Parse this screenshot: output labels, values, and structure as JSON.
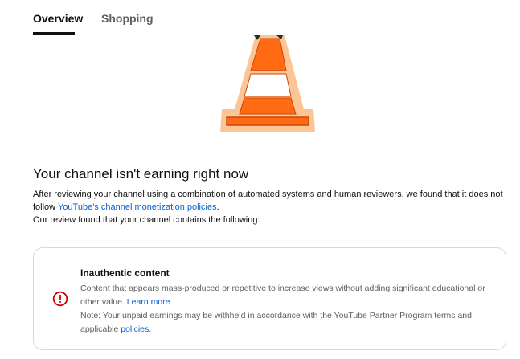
{
  "tabs": {
    "overview": "Overview",
    "shopping": "Shopping"
  },
  "status": {
    "title": "Your channel isn't earning right now",
    "intro": "After reviewing your channel using a combination of automated systems and human reviewers, we found that it does not follow",
    "policy_link": "YouTube's channel monetization policies",
    "intro_end": ".",
    "review_line": "Our review found that your channel contains the following:"
  },
  "violation": {
    "title": "Inauthentic content",
    "description": "Content that appears mass-produced or repetitive to increase views without adding significant educational or other value.",
    "learn_more": "Learn more",
    "note": "Note: Your unpaid earnings may be withheld in accordance with the YouTube Partner Program terms and applicable",
    "policies_link": "policies",
    "note_end": "."
  },
  "colors": {
    "link": "#065fd4",
    "alert_icon": "#cc0000",
    "cone_orange": "#ff6a13",
    "cone_glow": "#fbc596"
  },
  "icons": {
    "alert": "alert-circle-icon",
    "illustration": "traffic-cone-illustration"
  }
}
